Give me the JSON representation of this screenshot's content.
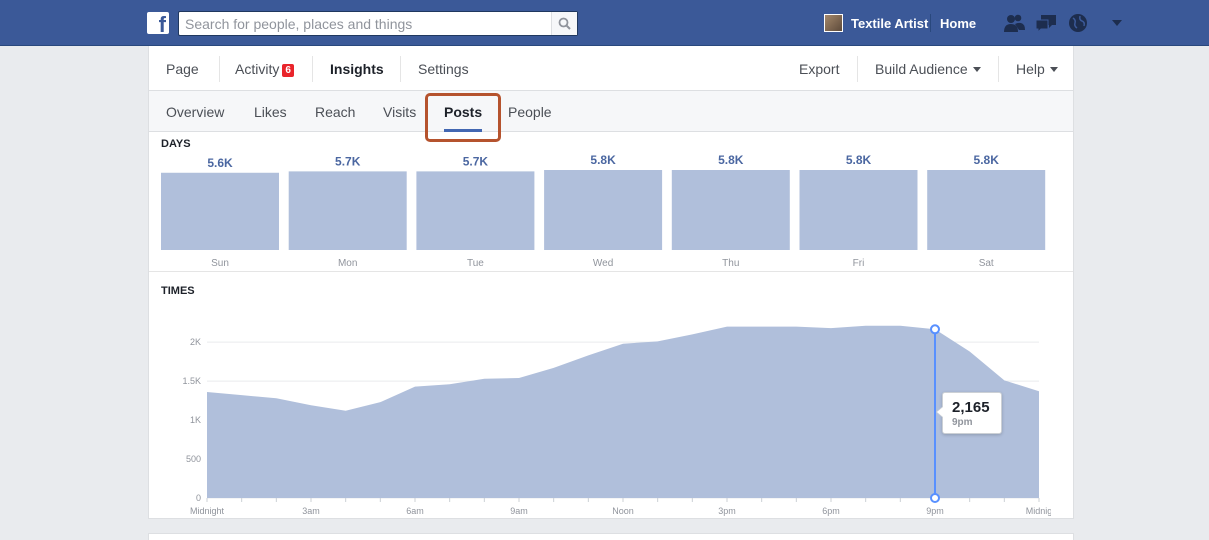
{
  "topbar": {
    "logo": "f",
    "search_placeholder": "Search for people, places and things",
    "page_name": "Textile Artist",
    "home_label": "Home",
    "icons": [
      "friend-requests-icon",
      "messages-icon",
      "notifications-globe-icon"
    ]
  },
  "page_nav": {
    "page": "Page",
    "activity": "Activity",
    "activity_badge": "6",
    "insights": "Insights",
    "settings": "Settings",
    "export": "Export",
    "build_audience": "Build Audience",
    "help": "Help"
  },
  "insights_tabs": {
    "overview": "Overview",
    "likes": "Likes",
    "reach": "Reach",
    "visits": "Visits",
    "posts": "Posts",
    "people": "People",
    "active": "Posts"
  },
  "days_section": {
    "label": "DAYS"
  },
  "times_section": {
    "label": "TIMES"
  },
  "tooltip": {
    "value": "2,165",
    "label": "9pm"
  },
  "colors": {
    "topbar": "#3b5998",
    "chart_fill": "#b0bfdb",
    "chart_marker": "#5890ff",
    "highlight_box": "#b5532e",
    "badge": "#e9242b"
  },
  "chart_data": [
    {
      "type": "bar",
      "title": "DAYS",
      "categories": [
        "Sun",
        "Mon",
        "Tue",
        "Wed",
        "Thu",
        "Fri",
        "Sat"
      ],
      "values": [
        5600,
        5700,
        5700,
        5800,
        5800,
        5800,
        5800
      ],
      "data_labels": [
        "5.6K",
        "5.7K",
        "5.7K",
        "5.8K",
        "5.8K",
        "5.8K",
        "5.8K"
      ]
    },
    {
      "type": "area",
      "title": "TIMES",
      "x": [
        "Midnight",
        "1am",
        "2am",
        "3am",
        "4am",
        "5am",
        "6am",
        "7am",
        "8am",
        "9am",
        "10am",
        "11am",
        "Noon",
        "1pm",
        "2pm",
        "3pm",
        "4pm",
        "5pm",
        "6pm",
        "7pm",
        "8pm",
        "9pm",
        "10pm",
        "11pm",
        "Midnight"
      ],
      "values": [
        1360,
        1320,
        1280,
        1190,
        1120,
        1230,
        1430,
        1460,
        1530,
        1540,
        1670,
        1830,
        1980,
        2010,
        2100,
        2200,
        2200,
        2200,
        2180,
        2210,
        2210,
        2165,
        1880,
        1510,
        1370
      ],
      "x_tick_labels": [
        "Midnight",
        "3am",
        "6am",
        "9am",
        "Noon",
        "3pm",
        "6pm",
        "9pm",
        "Midnig"
      ],
      "y_tick_labels": [
        "0",
        "500",
        "1K",
        "1.5K",
        "2K"
      ],
      "ylim": [
        0,
        2400
      ],
      "grid": true,
      "highlight": {
        "x": "9pm",
        "value": 2165
      }
    }
  ]
}
